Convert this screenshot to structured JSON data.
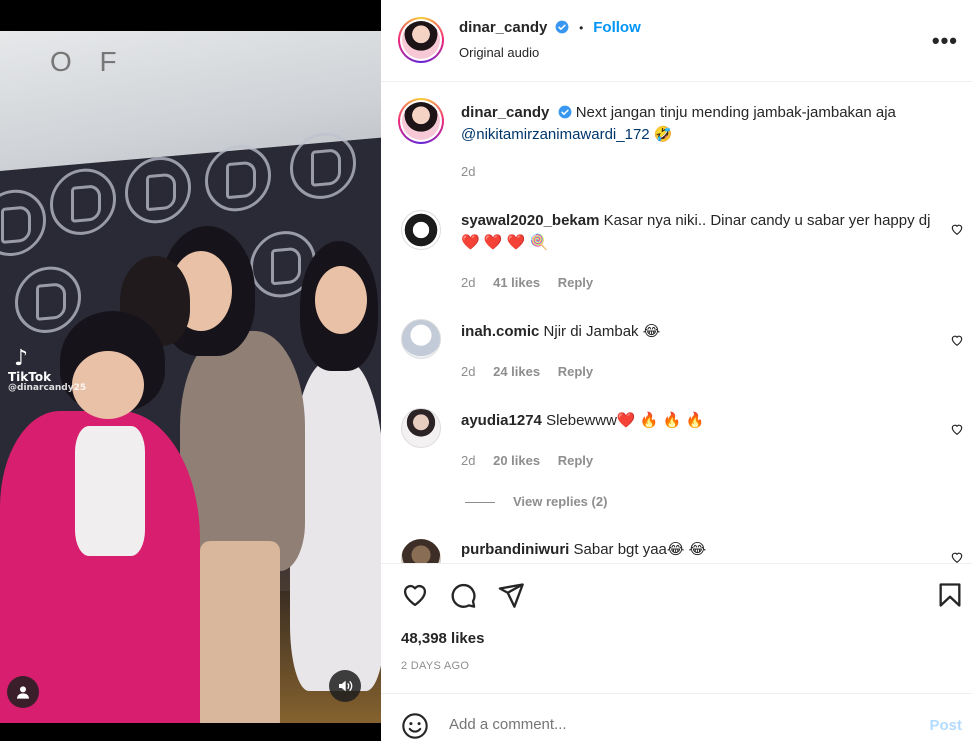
{
  "post": {
    "username": "dinar_candy",
    "follow_label": "Follow",
    "separator": "•",
    "audio": "Original audio",
    "more": "•••"
  },
  "media": {
    "wall_text": "O F",
    "tiktok_label": "TikTok",
    "tiktok_user": "@dinarcandy25"
  },
  "caption": {
    "username": "dinar_candy",
    "text": "Next jangan tinju mending jambak-jambakan aja",
    "mention": "@nikitamirzanimawardi_172",
    "emoji": "🤣",
    "time": "2d"
  },
  "comments": [
    {
      "username": "syawal2020_bekam",
      "text": "Kasar nya niki.. Dinar candy u sabar yer happy dj ❤️ ❤️ ❤️ 🍭",
      "time": "2d",
      "likes": "41 likes",
      "reply": "Reply"
    },
    {
      "username": "inah.comic",
      "text": "Njir di Jambak 😂",
      "time": "2d",
      "likes": "24 likes",
      "reply": "Reply"
    },
    {
      "username": "ayudia1274",
      "text": "Slebewww❤️ 🔥 🔥 🔥",
      "time": "2d",
      "likes": "20 likes",
      "reply": "Reply",
      "view_replies": "View replies (2)"
    },
    {
      "username": "purbandiniwuri",
      "text": "Sabar bgt yaa😂 😂"
    }
  ],
  "footer": {
    "likes": "48,398 likes",
    "date": "2 DAYS AGO",
    "add_comment_placeholder": "Add a comment...",
    "post_label": "Post"
  },
  "colors": {
    "accent": "#0095f6",
    "verified": "#3897f0",
    "muted": "#8e8e8e",
    "post_disabled": "#b3dbff"
  }
}
